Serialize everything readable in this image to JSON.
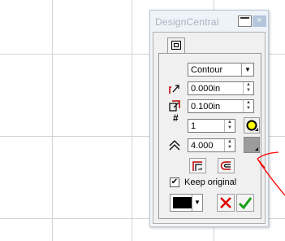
{
  "palette": {
    "title": "DesignCentral",
    "close_glyph": "×",
    "mode": {
      "selected": "Contour"
    },
    "offset": {
      "value": "0.000in",
      "icon": "offset-icon"
    },
    "distance": {
      "value": "0.100in",
      "icon": "distance-icon"
    },
    "count": {
      "label": "#",
      "value": "1"
    },
    "angle": {
      "value": "4.000",
      "icon": "angle-icon"
    },
    "keep_original": {
      "checked": "✔",
      "label": "Keep original"
    },
    "fill_color": "#000000",
    "buttons": {
      "cancel": "×",
      "apply": "✔"
    }
  },
  "colors": {
    "accent_yellow": "#ffff00",
    "cancel_red": "#e00000",
    "apply_green": "#16a016",
    "annotation_red": "#ff0000"
  }
}
